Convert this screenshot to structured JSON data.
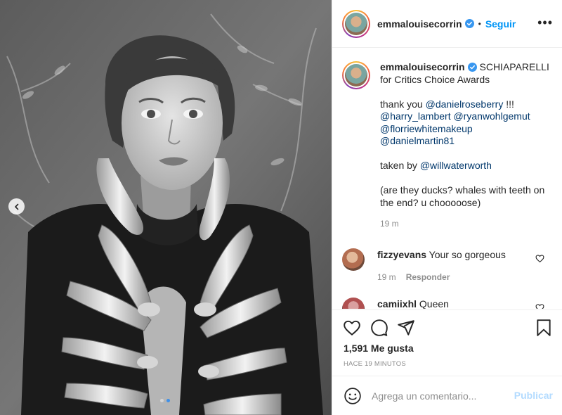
{
  "post": {
    "username": "emmalouisecorrin",
    "follow_label": "Seguir",
    "separator": "•",
    "more_label": "•••",
    "caption": {
      "username": "emmalouisecorrin",
      "lead": " SCHIAPARELLI for Critics Choice Awards",
      "thanks_prefix": "thank you ",
      "mentions_line1": "@danielroseberry",
      "thanks_suffix": " !!!",
      "mention_a": "@harry_lambert",
      "mention_b": "@ryanwohlgemut",
      "mention_c": "@florriewhitemakeup",
      "mention_d": "@danielmartin81",
      "taken_prefix": "taken by ",
      "mention_e": "@willwaterworth",
      "question": "(are they ducks? whales with teeth on the end? u chooooose)",
      "time": "19 m"
    },
    "comments": [
      {
        "username": "fizzyevans",
        "text": " Your so gorgeous",
        "time": "19 m",
        "reply_label": "Responder"
      },
      {
        "username": "camiixhl",
        "text": " Queen"
      }
    ],
    "likes": "1,591 Me gusta",
    "posted_ago": "HACE 19 MINUTOS",
    "comment_placeholder": "Agrega un comentario...",
    "publish_label": "Publicar",
    "carousel": {
      "count": 2,
      "active_index": 1
    }
  },
  "icons": [
    "verified-badge-icon",
    "chevron-left-icon",
    "heart-icon",
    "comment-icon",
    "share-icon",
    "bookmark-icon",
    "emoji-icon",
    "more-icon"
  ],
  "colors": {
    "accent": "#0095f6",
    "mention": "#00376b",
    "muted": "#8e8e8e",
    "publish_disabled": "#b3dbff",
    "verified": "#3897f0"
  }
}
